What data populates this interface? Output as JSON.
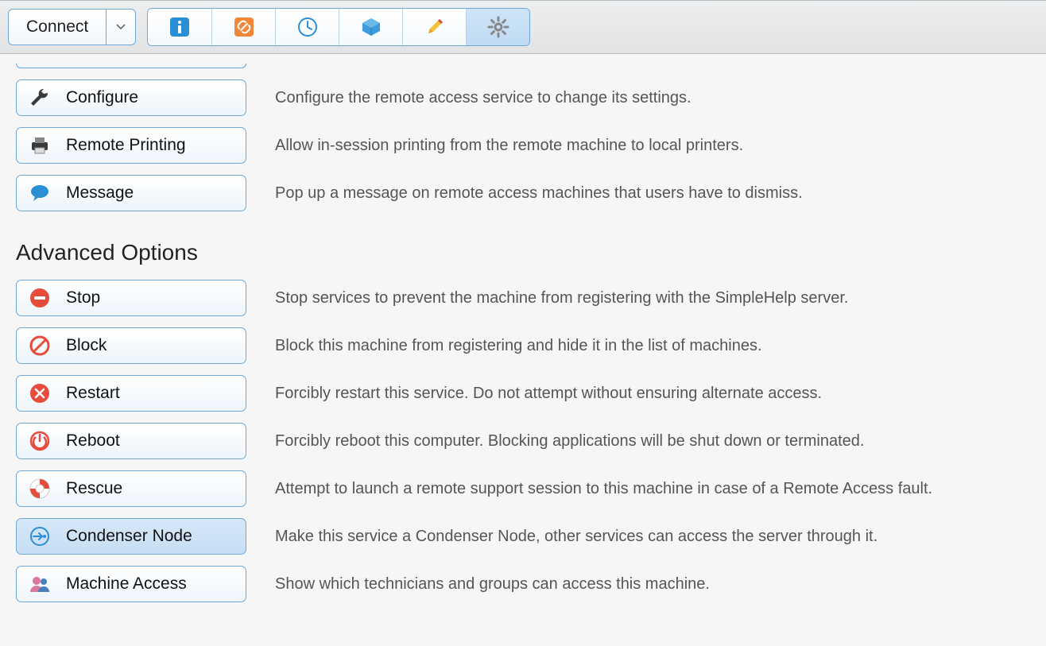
{
  "toolbar": {
    "connect_label": "Connect",
    "tabs": [
      {
        "name": "info-icon"
      },
      {
        "name": "link-icon"
      },
      {
        "name": "clock-icon"
      },
      {
        "name": "cube-icon"
      },
      {
        "name": "pencil-icon"
      },
      {
        "name": "gear-icon"
      }
    ]
  },
  "basic_options": [
    {
      "label": "Configure",
      "desc": "Configure the remote access service to change its settings."
    },
    {
      "label": "Remote Printing",
      "desc": "Allow in-session printing from the remote machine to local printers."
    },
    {
      "label": "Message",
      "desc": "Pop up a message on remote access machines that users have to dismiss."
    }
  ],
  "section_title": "Advanced Options",
  "advanced_options": [
    {
      "label": "Stop",
      "desc": "Stop services to prevent the machine from registering with the SimpleHelp server."
    },
    {
      "label": "Block",
      "desc": "Block this machine from registering and hide it in the list of machines."
    },
    {
      "label": "Restart",
      "desc": "Forcibly restart this service. Do not attempt without ensuring alternate access."
    },
    {
      "label": "Reboot",
      "desc": "Forcibly reboot this computer. Blocking applications will be shut down or terminated."
    },
    {
      "label": "Rescue",
      "desc": "Attempt to launch a remote support session to this machine in case of a Remote Access fault."
    },
    {
      "label": "Condenser Node",
      "desc": "Make this service a Condenser Node, other services can access the server through it.",
      "selected": true
    },
    {
      "label": "Machine Access",
      "desc": "Show which technicians and groups can access this machine."
    }
  ]
}
